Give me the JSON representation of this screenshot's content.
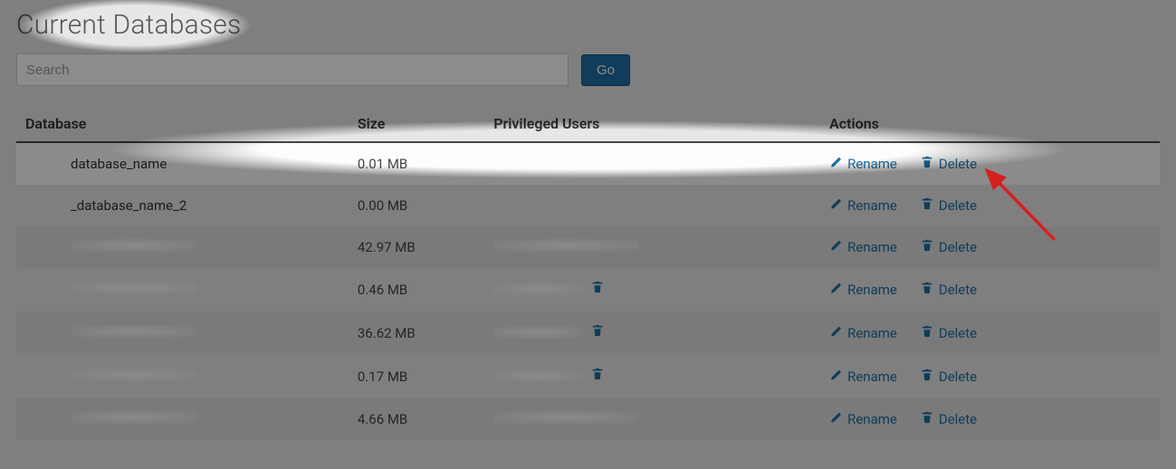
{
  "title": "Current Databases",
  "search": {
    "placeholder": "Search",
    "go_label": "Go"
  },
  "columns": {
    "db": "Database",
    "size": "Size",
    "priv": "Privileged Users",
    "actions": "Actions"
  },
  "actions": {
    "rename": "Rename",
    "delete": "Delete"
  },
  "rows": [
    {
      "name": "database_name",
      "size": "0.01 MB",
      "priv_trash": false,
      "highlight": true
    },
    {
      "name": "_database_name_2",
      "size": "0.00 MB",
      "priv_trash": false
    },
    {
      "name": "",
      "size": "42.97 MB",
      "priv_trash": false,
      "redact": true
    },
    {
      "name": "",
      "size": "0.46 MB",
      "priv_trash": true,
      "redact": true
    },
    {
      "name": "",
      "size": "36.62 MB",
      "priv_trash": true,
      "redact": true
    },
    {
      "name": "",
      "size": "0.17 MB",
      "priv_trash": true,
      "redact": true
    },
    {
      "name": "",
      "size": "4.66 MB",
      "priv_trash": false,
      "redact": true
    }
  ]
}
